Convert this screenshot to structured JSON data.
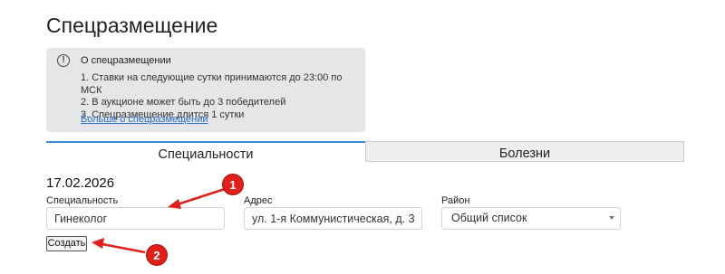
{
  "page": {
    "title": "Спецразмещение"
  },
  "info": {
    "icon": "info-circle-icon",
    "icon_glyph": "!",
    "title": "О спецразмещении",
    "items": [
      "1. Ставки на следующие сутки принимаются до 23:00 по МСК",
      "2. В аукционе может быть до 3 победителей",
      "3. Спецразмещение длится 1 сутки"
    ],
    "link": "Больше о спецразмещении"
  },
  "tabs": [
    {
      "label": "Специальности",
      "active": true
    },
    {
      "label": "Болезни",
      "active": false
    }
  ],
  "form": {
    "date": "17.02.2026",
    "specialty": {
      "label": "Специальность",
      "value": "Гинеколог"
    },
    "address": {
      "label": "Адрес",
      "value": "ул. 1-я Коммунистическая, д. 31"
    },
    "district": {
      "label": "Район",
      "value": "Общий список"
    },
    "create_label": "Создать"
  },
  "annotations": {
    "color": "#e0211b",
    "markers": [
      "1",
      "2"
    ]
  }
}
